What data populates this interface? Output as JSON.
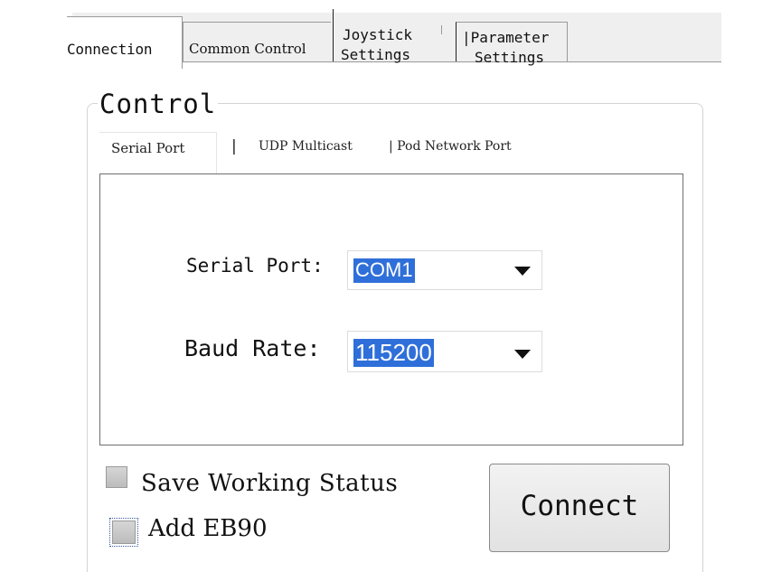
{
  "tabs": {
    "connection": "Connection",
    "common_control": "Common Control",
    "joystick_line1": "Joystick",
    "joystick_line2": "Settings",
    "parameter_line1": "|Parameter",
    "parameter_line2": "Settings",
    "active": "Connection"
  },
  "group": {
    "title": "Control"
  },
  "subtabs": {
    "serial_port": "Serial Port",
    "separator": "|",
    "udp_multicast": "UDP Multicast",
    "pod_network_port": "| Pod Network Port",
    "active": "Serial Port"
  },
  "form": {
    "serial_port_label": "Serial Port:",
    "serial_port_value": "COM1",
    "baud_rate_label": "Baud Rate:",
    "baud_rate_value": "115200"
  },
  "options": {
    "save_working_status": "Save Working Status",
    "save_working_status_checked": false,
    "add_eb90": "Add EB90",
    "add_eb90_checked": false
  },
  "actions": {
    "connect_label": "Connect"
  },
  "colors": {
    "selection": "#2f6fd9",
    "tabstrip_bg": "#efefef",
    "panel_border": "#6e6e6e"
  },
  "icons": {
    "combo_arrow": "dropdown-arrow-icon"
  }
}
